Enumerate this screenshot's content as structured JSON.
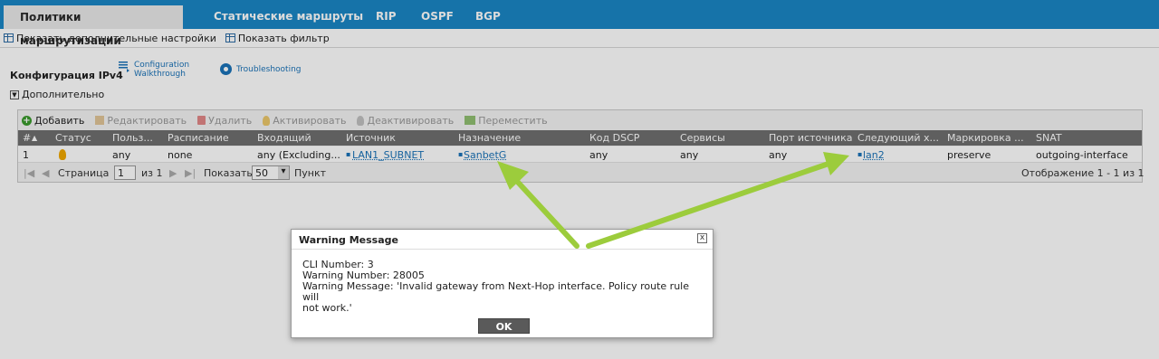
{
  "tabs": [
    {
      "label": "Политики маршрутизации",
      "active": true
    },
    {
      "label": "Статические маршруты"
    },
    {
      "label": "RIP"
    },
    {
      "label": "OSPF"
    },
    {
      "label": "BGP"
    }
  ],
  "subbar": {
    "show_advanced": "Показать дополнительные настройки",
    "show_filter": "Показать фильтр"
  },
  "section": {
    "title": "Конфигурация IPv4",
    "walkthrough_line1": "Configuration",
    "walkthrough_line2": "Walkthrough",
    "troubleshooting": "Troubleshooting",
    "advanced": "Дополнительно"
  },
  "actions": {
    "add": "Добавить",
    "edit": "Редактировать",
    "delete": "Удалить",
    "activate": "Активировать",
    "deactivate": "Деактивировать",
    "move": "Переместить"
  },
  "table": {
    "headers": [
      "#",
      "Статус",
      "Польз...",
      "Расписание",
      "Входящий",
      "Источник",
      "Назначение",
      "Код DSCP",
      "Сервисы",
      "Порт источника",
      "Следующий х...",
      "Маркировка ...",
      "SNAT"
    ],
    "sort_indicator": "▲",
    "rows": [
      {
        "num": "1",
        "user": "any",
        "schedule": "none",
        "incoming": "any (Excluding...",
        "source": "LAN1_SUBNET",
        "destination": "SanbetG",
        "dscp": "any",
        "service": "any",
        "source_port": "any",
        "next_hop": "lan2",
        "marking": "preserve",
        "snat": "outgoing-interface"
      }
    ]
  },
  "pager": {
    "page_label": "Страница",
    "page_value": "1",
    "of_label": "из 1",
    "show_label": "Показать",
    "per_page": "50",
    "items_label": "Пункт",
    "summary": "Отображение 1 - 1 из 1"
  },
  "dialog": {
    "title": "Warning Message",
    "close": "x",
    "line1": "CLI Number: 3",
    "line2": "Warning Number: 28005",
    "line3": "Warning Message: 'Invalid gateway from Next-Hop interface. Policy route rule will",
    "line4": "not work.'",
    "ok": "OK"
  },
  "colors": {
    "tabbar": "#1a86c5",
    "header_row": "#6f6f6f",
    "link": "#1a73b8",
    "arrow": "#9ccc3c"
  }
}
